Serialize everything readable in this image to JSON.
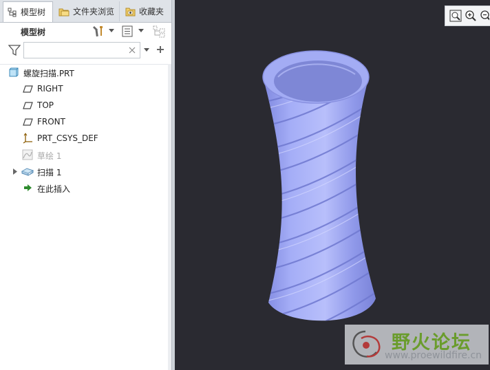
{
  "tabs": [
    {
      "label": "模型树",
      "icon": "model-tree-icon",
      "active": true
    },
    {
      "label": "文件夹浏览",
      "icon": "folder-browser-icon",
      "active": false
    },
    {
      "label": "收藏夹",
      "icon": "favorites-icon",
      "active": false
    }
  ],
  "toolbar": {
    "title": "模型树"
  },
  "search": {
    "value": "",
    "placeholder": ""
  },
  "tree": {
    "root": {
      "label": "螺旋扫描.PRT",
      "icon": "part-icon"
    },
    "items": [
      {
        "label": "RIGHT",
        "icon": "datum-plane-icon"
      },
      {
        "label": "TOP",
        "icon": "datum-plane-icon"
      },
      {
        "label": "FRONT",
        "icon": "datum-plane-icon"
      },
      {
        "label": "PRT_CSYS_DEF",
        "icon": "coordinate-system-icon"
      },
      {
        "label": "草绘 1",
        "icon": "sketch-icon",
        "state": "suppressed"
      },
      {
        "label": "扫描 1",
        "icon": "sweep-icon",
        "expandable": true
      },
      {
        "label": "在此插入",
        "icon": "insert-arrow-icon"
      }
    ]
  },
  "viewport": {
    "background": "#2a2a31",
    "model_color": "#9ba4f2"
  },
  "watermark": {
    "title": "野火论坛",
    "url": "www.proewildfire.cn"
  }
}
